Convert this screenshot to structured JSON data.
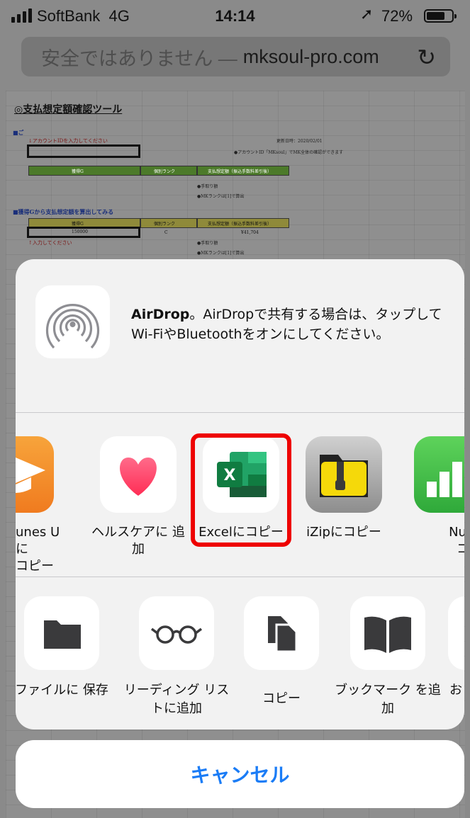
{
  "status": {
    "carrier": "SoftBank",
    "network": "4G",
    "time": "14:14",
    "battery_pct": "72%",
    "battery_level": 0.72
  },
  "address_bar": {
    "insecure": "安全ではありません —",
    "domain": "mksoul-pro.com"
  },
  "page": {
    "title": "◎支払想定額確認ツール",
    "section1": "■ご",
    "input_hint": "↓アカウントIDを入力してください",
    "updated": "更新日時：2020/02/01",
    "note1": "●アカウントID「MKsoul」でMK全体の確認ができます",
    "header_g": "獲得G",
    "header_rank": "個別ランク",
    "header_amount": "支払想定額（振込手数料差引後）",
    "fee_note": "●手取り額",
    "rank_note": "●MKランクは[1]で算出",
    "section2": "■獲得Gから支払想定額を算出してみる",
    "g_value": "150000",
    "rank_value": "C",
    "amount_value": "¥41,704",
    "input_hint2": "↑入力してください"
  },
  "share_sheet": {
    "airdrop_title": "AirDrop",
    "airdrop_text": "。AirDropで共有する場合は、タップして Wi-FiやBluetoothをオンにしてください。",
    "apps": [
      {
        "label": "iTunes Uに コピー",
        "visible_label": "unes Uに\nコピー",
        "icon": "itunes-u-icon"
      },
      {
        "label": "ヘルスケアに 追加",
        "icon": "health-icon"
      },
      {
        "label": "Excelにコピー",
        "icon": "excel-icon"
      },
      {
        "label": "iZipにコピー",
        "icon": "izip-icon"
      },
      {
        "label": "Numbersに コピー",
        "visible_label": "Numbe\nコピー",
        "icon": "numbers-icon"
      }
    ],
    "actions": [
      {
        "label": "ファイルに 保存",
        "icon": "folder-icon"
      },
      {
        "label": "リーディング リストに追加",
        "icon": "glasses-icon"
      },
      {
        "label": "コピー",
        "icon": "copy-icon"
      },
      {
        "label": "ブックマーク を追加",
        "icon": "book-icon"
      },
      {
        "label": "お",
        "icon": "favorite-icon"
      }
    ],
    "cancel": "キャンセル"
  },
  "colors": {
    "accent": "#1a7cf6",
    "highlight": "#ee0000",
    "excel_green": "#1d6f42"
  }
}
